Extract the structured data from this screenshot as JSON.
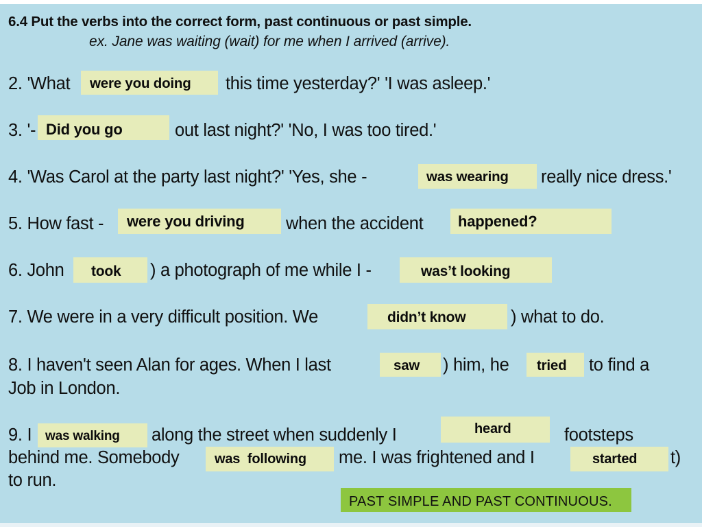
{
  "slide": {
    "background_color": "#b6dce8",
    "highlight_color": "#e6ecba",
    "banner_color": "#8dc63f",
    "text_color": "#101010"
  },
  "header": {
    "title": "6.4 Put the verbs into the correct form, past continuous or past simple.",
    "example": "ex. Jane was waiting (wait) for me when I arrived (arrive)."
  },
  "exercises": [
    {
      "number": "2.",
      "parts": [
        {
          "kind": "text",
          "value": "2. 'What"
        },
        {
          "kind": "answer",
          "value": "were you doing"
        },
        {
          "kind": "text",
          "value": "this time yesterday?' 'I was asleep.'"
        }
      ]
    },
    {
      "number": "3.",
      "parts": [
        {
          "kind": "text",
          "value": "3. '-"
        },
        {
          "kind": "answer",
          "value": "Did you go"
        },
        {
          "kind": "text",
          "value": "out last night?' 'No, I was too tired.'"
        }
      ]
    },
    {
      "number": "4.",
      "parts": [
        {
          "kind": "text",
          "value": "4. 'Was Carol at the party last night?' 'Yes, she -"
        },
        {
          "kind": "answer",
          "value": "was wearing"
        },
        {
          "kind": "text",
          "value": "really nice dress.'"
        }
      ]
    },
    {
      "number": "5.",
      "parts": [
        {
          "kind": "text",
          "value": "5. How fast -"
        },
        {
          "kind": "answer",
          "value": "were you driving"
        },
        {
          "kind": "text",
          "value": "when the accident"
        },
        {
          "kind": "answer",
          "value": "happened?"
        }
      ]
    },
    {
      "number": "6.",
      "parts": [
        {
          "kind": "text",
          "value": "6. John"
        },
        {
          "kind": "answer",
          "value": "took"
        },
        {
          "kind": "text",
          "value": ") a photograph of me while I -"
        },
        {
          "kind": "answer",
          "value": "was’t looking"
        }
      ]
    },
    {
      "number": "7.",
      "parts": [
        {
          "kind": "text",
          "value": "7. We were in a very difficult position. We"
        },
        {
          "kind": "answer",
          "value": "didn’t know"
        },
        {
          "kind": "text",
          "value": ") what to do."
        }
      ]
    },
    {
      "number": "8.",
      "parts": [
        {
          "kind": "text",
          "value": "8. I haven't seen Alan for ages. When I last"
        },
        {
          "kind": "answer",
          "value": "saw"
        },
        {
          "kind": "text",
          "value": ") him, he"
        },
        {
          "kind": "answer",
          "value": "tried"
        },
        {
          "kind": "text",
          "value": "to find a"
        },
        {
          "kind": "text",
          "value": "Job in London."
        }
      ]
    },
    {
      "number": "9.",
      "parts": [
        {
          "kind": "text",
          "value": "9. I"
        },
        {
          "kind": "answer",
          "value": "was walking"
        },
        {
          "kind": "text",
          "value": "along the street when suddenly I"
        },
        {
          "kind": "answer",
          "value": "heard"
        },
        {
          "kind": "text",
          "value": "footsteps"
        },
        {
          "kind": "text",
          "value": "behind me. Somebody"
        },
        {
          "kind": "answer",
          "value": "was  following"
        },
        {
          "kind": "text",
          "value": "me. I was frightened and I"
        },
        {
          "kind": "answer",
          "value": "started"
        },
        {
          "kind": "text",
          "value": "t)"
        },
        {
          "kind": "text",
          "value": "to run."
        }
      ]
    }
  ],
  "lines": {
    "l2a": "2. 'What",
    "l2b": "this time yesterday?' 'I was asleep.'",
    "l3a": "3. '-",
    "l3b": "out last night?' 'No, I was too tired.'",
    "l4a": "4. 'Was Carol at the party last night?' 'Yes, she -",
    "l4b": "really nice dress.'",
    "l5a": "5. How fast -",
    "l5b": "when the accident",
    "l6a": "6. John",
    "l6b": ") a photograph of me while I -",
    "l7a": "7. We were in a very difficult position. We",
    "l7b": ") what to do.",
    "l8a": "8. I haven't seen Alan for ages. When I last",
    "l8b": ") him, he",
    "l8c": "to find a",
    "l8d": "Job in London.",
    "l9a": "9. I",
    "l9b": "along the street when suddenly I",
    "l9c": "footsteps",
    "l9d": "behind me. Somebody",
    "l9e": "me. I was frightened and I",
    "l9f": "t)",
    "l9g": "to run."
  },
  "answers": {
    "a2": "were you doing",
    "a3": "Did you go",
    "a4": "was wearing",
    "a5a": "were you driving",
    "a5b": "happened?",
    "a6a": "took",
    "a6b": "was’t looking",
    "a7": "didn’t know",
    "a8a": "saw",
    "a8b": "tried",
    "a9a": "was walking",
    "a9b": "heard",
    "a9c": "was  following",
    "a9d": "started"
  },
  "banner": {
    "label": "PAST SIMPLE AND PAST CONTINUOUS."
  }
}
